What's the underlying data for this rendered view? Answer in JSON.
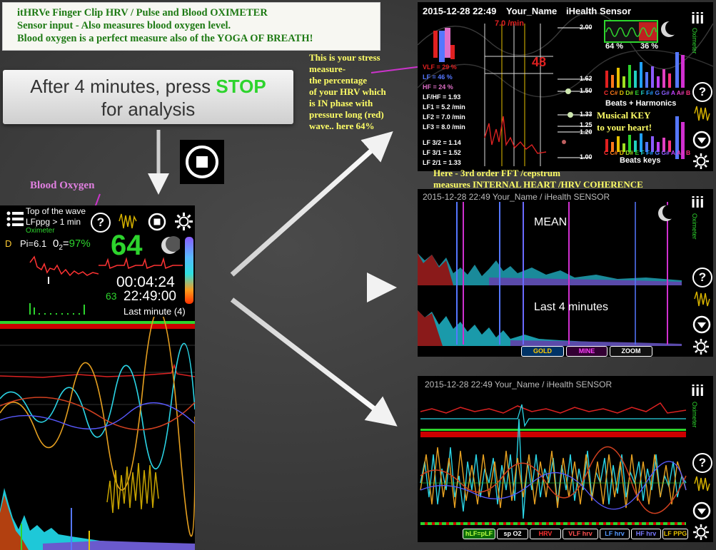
{
  "intro": {
    "line1": "itHRVe  Finger Clip   HRV / Pulse and Blood OXIMETER",
    "line2": "Sensor input -  Also measures blood oxygen level.",
    "line3": "Blood oxygen is a perfect measure also of the YOGA OF BREATH!"
  },
  "instruction": {
    "line1_prefix": "After 4 minutes, press ",
    "line1_stop": "STOP",
    "line2": "for analysis"
  },
  "annotations": {
    "blood_oxygen": "Blood Oxygen",
    "stress_1": "This is your stress",
    "stress_2": "measure-",
    "stress_3": " the percentage",
    "stress_4": "of your HRV which",
    "stress_5": "is IN phase with",
    "stress_6": "pressure long (red)",
    "stress_7": "wave.. here 64%",
    "key_1": "Musical KEY",
    "key_2": "to your heart!",
    "fft_1": "Here - 3rd order FFT /cepstrum",
    "fft_2": "measures INTERNAL HEART /HRV  COHERENCE"
  },
  "left_panel": {
    "top_line1": "Top of the wave",
    "top_line2": "LFppg > 1 min",
    "oximeter": "Oximeter",
    "d": "D",
    "pi": "Pi=6.1",
    "o2_label": "0",
    "o2_sub": "2",
    "o2_eq": "=",
    "o2_value": "97%",
    "heart_rate": "64",
    "elapsed": "00:04:24",
    "avg": "63",
    "clock": "22:49:00",
    "last_minute": "Last minute (4)"
  },
  "panel1": {
    "datetime": "2015-12-28 22:49",
    "user": "Your_Name",
    "sensor": "iHealth Sensor",
    "rate": "7.0 /min",
    "big_value": "48",
    "vlf": "VLF = 29 %",
    "lf": "LF = 46 %",
    "hf": "HF = 24 %",
    "lfhf": "LF/HF = 1.93",
    "lf1": "LF1 = 5.2 /min",
    "lf2": "LF2 = 7.0 /min",
    "lf3": "LF3 = 8.0 /min",
    "lf32": "LF 3/2 = 1.14",
    "lf31": "LF 3/1 = 1.52",
    "lf21": "LF 2/1 = 1.33",
    "scale_200": "2.00",
    "scale_162": "1.62",
    "scale_150": "1.50",
    "scale_133": "1.33",
    "scale_125": "1.25",
    "scale_120": "1.20",
    "scale_100": "1.00",
    "pct_left": "64 %",
    "pct_right": "36 %",
    "beats_harmonics": "Beats + Harmonics",
    "beats_keys": "Beats   keys",
    "notes": [
      "C",
      "C#",
      "D",
      "D#",
      "E",
      "F",
      "F#",
      "G",
      "G#",
      "A",
      "A#",
      "B"
    ],
    "oximeter": "Oximeter",
    "menu": "iii"
  },
  "panel2": {
    "header": "2015-12-28 22:49   Your_Name  /  iHealth SENSOR",
    "mean": "MEAN",
    "last4": "Last 4 minutes",
    "btn_gold": "GOLD",
    "btn_mine": "MINE",
    "btn_zoom": "ZOOM",
    "oximeter": "Oximeter",
    "menu": "iii"
  },
  "panel3": {
    "header": "2015-12-28 22:49   Your_Name  /  iHealth SENSOR",
    "oximeter": "Oximeter",
    "menu": "iii",
    "legend": [
      "hLF=pLF",
      "sp O2",
      "HRV",
      "VLF hrv",
      "LF hrv",
      "HF hrv",
      "LF PPG"
    ]
  },
  "colors": {
    "accent_green": "#2dd42d",
    "note_yellow": "#ffff66",
    "note_purple": "#e080e0",
    "stress_purple": "#cc33cc"
  }
}
